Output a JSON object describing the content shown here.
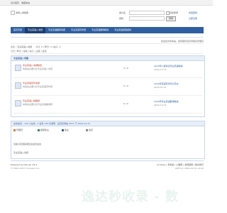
{
  "topbar": {
    "left": "设为首页",
    "right": "收藏本站"
  },
  "logo": {
    "text": "考场入场题库"
  },
  "login": {
    "user_label": "用户名",
    "pass_label": "密码",
    "auto_login": "自动登录",
    "find_pass": "找回密码",
    "login_button": "登录",
    "register_button": "立即注册"
  },
  "nav": {
    "items": [
      "首页专题",
      "专业英语八考题",
      "专业英语翻译考题",
      "专业英语写作题",
      "专业英语翻译精讲",
      "专业英语题型结构"
    ],
    "active_index": 1,
    "accent": "#2f5fa1"
  },
  "notice": {
    "right": "欢迎您访问本站，如有疑问请及时联系管理员"
  },
  "crumb": {
    "path": "论坛 › 专业英语八考题",
    "right_info": "今日: 0 | 昨日: 0 | 帖子: 0"
  },
  "crumb2": {
    "text": "今日 | 昨日 | 最新 | 帖子 | 主题 | 会员"
  },
  "panel": {
    "title": "专业英语八考题",
    "rows": [
      {
        "title": "专业英语八考题精选",
        "desc": "本版块主要讨论专业英语八考题",
        "mid": "0 / 0",
        "last": "2024年八级考试专业英语精讲",
        "last_time": "2024-12-31"
      },
      {
        "title": "专业英语写作考题",
        "desc": "本版块主要讨论专业英语写作题",
        "mid": "0 / 0",
        "last": "2024年英语写作高分范文",
        "last_time": "2024-12-31"
      },
      {
        "title": "专业英语八级翻译",
        "desc": "本版块主要讨论专业英语翻译题",
        "mid": "0 / 0",
        "last": "2024年专业英语翻译精讲",
        "last_time": "2024-12-31"
      }
    ]
  },
  "stats": {
    "title": "在线会员 - 139 人在线 - 0 会员 139 位游客 - 最高纪录是 2571 于 2024-12-31",
    "legend": [
      "管理员",
      "超级版主",
      "版主",
      "会员"
    ],
    "legend_colors": [
      "#e07b28",
      "#2e8b57",
      "#2f5fa1",
      "#888888"
    ],
    "line1": "当前只有游客或隐身会员在线",
    "line2": "专业英语八考题"
  },
  "footer": {
    "left": "Powered by Discuz! X3.4",
    "left2": "© 2001-2017 Comsenz Inc.",
    "right": "Archiver | 手机版 | 小黑屋 | 考场题库 | 联系我们",
    "right2": "GMT+8, 2024-12-31 12:00"
  },
  "watermark": {
    "text": "逸达秒收录 - 数"
  }
}
